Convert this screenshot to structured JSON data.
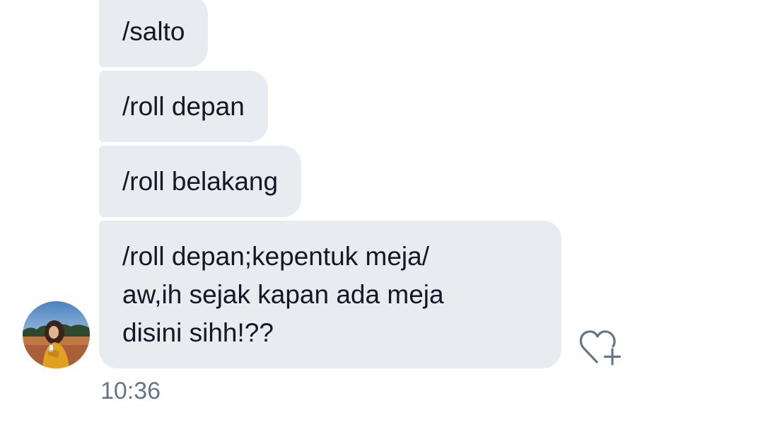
{
  "messages": [
    {
      "text": "/salto"
    },
    {
      "text": "/roll depan"
    },
    {
      "text": "/roll belakang"
    },
    {
      "lines": [
        "/roll depan;kepentuk meja/",
        "aw,ih sejak kapan ada meja",
        "disini sihh!??"
      ]
    }
  ],
  "timestamp": "10:36",
  "icons": {
    "like": "heart-plus-icon",
    "avatar": "avatar"
  },
  "colors": {
    "bubble": "#e8ecf0",
    "text": "#141823",
    "timestamp": "#66768a",
    "icon": "#66768a"
  }
}
